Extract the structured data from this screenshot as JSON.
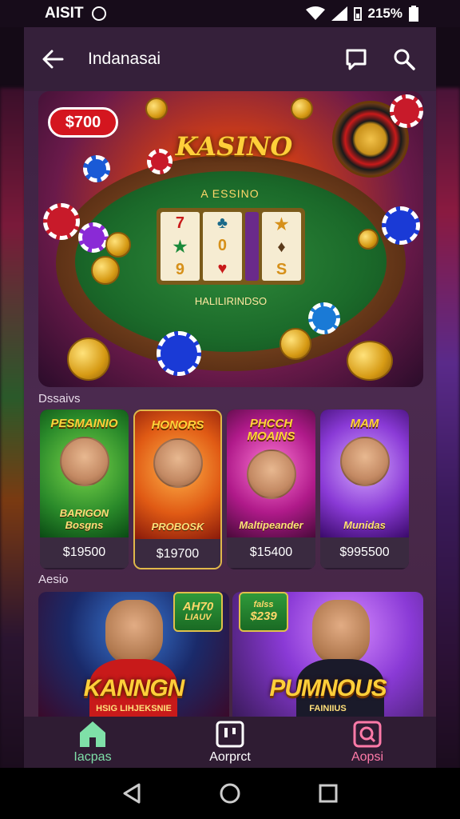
{
  "status_bar": {
    "left_text": "AISIT",
    "battery": "215%"
  },
  "topbar": {
    "title": "Indanasai"
  },
  "hero": {
    "price_chip": "$700",
    "logo": "KASINO",
    "subtitle": "A ESSINO",
    "caption": "HALILIRINDSO",
    "reel_symbols": [
      [
        "7",
        "★",
        "9"
      ],
      [
        "♣",
        "0",
        "♥"
      ],
      [
        "★",
        "♦",
        "S"
      ]
    ]
  },
  "section1_label": "Dssaivs",
  "cards": [
    {
      "title": "PESMAINIO",
      "sub": "BARIGON Bosgns",
      "price": "$19500",
      "color": "green"
    },
    {
      "title": "HONORS",
      "sub": "PROBOSK",
      "price": "$19700",
      "color": "orange"
    },
    {
      "title": "PHCCH MOAINS",
      "sub": "Maltipeander",
      "price": "$15400",
      "color": "magenta"
    },
    {
      "title": "MAM",
      "sub": "Munidas",
      "price": "$995500",
      "color": "violet"
    }
  ],
  "section2_label": "Aesio",
  "banners": [
    {
      "title": "KANNGN",
      "sub": "HSIG LIHJEKSNIE",
      "badge_line1": "AH70",
      "badge_line2": "LIAUV"
    },
    {
      "title": "PUMNOUS",
      "sub": "FAINIIUS",
      "badge_line1": "falss",
      "badge_line2": "$239"
    }
  ],
  "bottom_nav": [
    {
      "label": "Iacpas",
      "icon": "home-icon",
      "color": "#7fe0a8"
    },
    {
      "label": "Aorprct",
      "icon": "grid-icon",
      "color": "#ffffff"
    },
    {
      "label": "Aopsi",
      "icon": "search-square-icon",
      "color": "#ff7aa8"
    }
  ],
  "colors": {
    "app_bg": "#3b1f3f",
    "accent_green": "#7fe0a8",
    "accent_pink": "#ff7aa8",
    "gold": "#ffcf3a"
  }
}
